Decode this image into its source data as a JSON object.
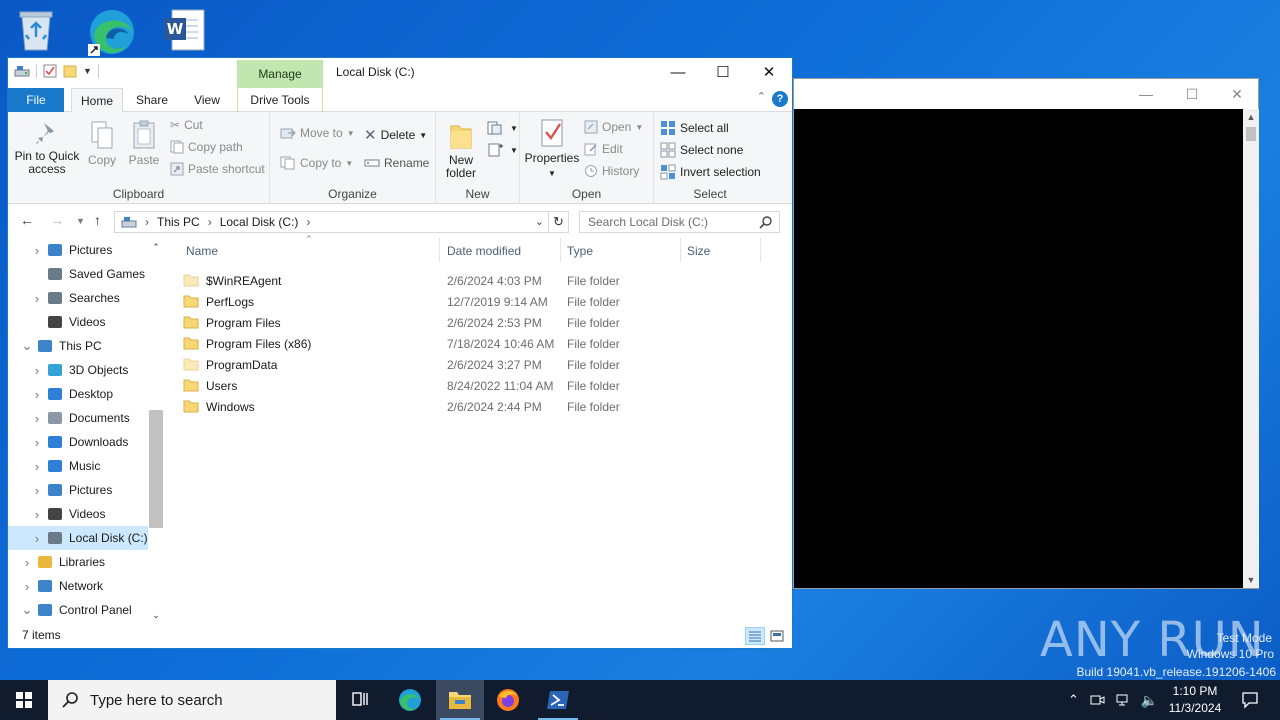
{
  "desktop": {
    "icons": [
      "recycle-bin-icon",
      "edge-icon",
      "word-icon"
    ]
  },
  "explorer": {
    "title": "Local Disk (C:)",
    "contextual_tab": "Manage",
    "tabs": {
      "file": "File",
      "home": "Home",
      "share": "Share",
      "view": "View",
      "drive_tools": "Drive Tools"
    },
    "ribbon": {
      "clipboard": {
        "label": "Clipboard",
        "pin": "Pin to Quick access",
        "copy": "Copy",
        "paste": "Paste",
        "cut": "Cut",
        "copy_path": "Copy path",
        "paste_shortcut": "Paste shortcut"
      },
      "organize": {
        "label": "Organize",
        "move_to": "Move to",
        "copy_to": "Copy to",
        "delete": "Delete",
        "rename": "Rename"
      },
      "new": {
        "label": "New",
        "new_folder": "New folder"
      },
      "open": {
        "label": "Open",
        "properties": "Properties",
        "open": "Open",
        "edit": "Edit",
        "history": "History"
      },
      "select": {
        "label": "Select",
        "select_all": "Select all",
        "select_none": "Select none",
        "invert": "Invert selection"
      }
    },
    "address": {
      "crumbs": [
        "This PC",
        "Local Disk (C:)"
      ],
      "search_placeholder": "Search Local Disk (C:)"
    },
    "nav": [
      {
        "label": "Pictures",
        "icon": "pictures-icon",
        "expandable": true
      },
      {
        "label": "Saved Games",
        "icon": "saved-games-icon",
        "expandable": false
      },
      {
        "label": "Searches",
        "icon": "searches-icon",
        "expandable": true
      },
      {
        "label": "Videos",
        "icon": "videos-icon",
        "expandable": false
      },
      {
        "label": "This PC",
        "icon": "this-pc-icon",
        "expandable": true
      },
      {
        "label": "3D Objects",
        "icon": "3d-objects-icon",
        "expandable": true
      },
      {
        "label": "Desktop",
        "icon": "desktop-icon",
        "expandable": true
      },
      {
        "label": "Documents",
        "icon": "documents-icon",
        "expandable": true
      },
      {
        "label": "Downloads",
        "icon": "downloads-icon",
        "expandable": true
      },
      {
        "label": "Music",
        "icon": "music-icon",
        "expandable": true
      },
      {
        "label": "Pictures",
        "icon": "pictures-icon",
        "expandable": true
      },
      {
        "label": "Videos",
        "icon": "videos-icon",
        "expandable": true
      },
      {
        "label": "Local Disk (C:)",
        "icon": "local-disk-icon",
        "expandable": true
      },
      {
        "label": "Libraries",
        "icon": "libraries-icon",
        "expandable": true
      },
      {
        "label": "Network",
        "icon": "network-icon",
        "expandable": true
      },
      {
        "label": "Control Panel",
        "icon": "control-panel-icon",
        "expandable": true
      }
    ],
    "columns": {
      "name": "Name",
      "date": "Date modified",
      "type": "Type",
      "size": "Size"
    },
    "files": [
      {
        "name": "$WinREAgent",
        "date": "2/6/2024 4:03 PM",
        "type": "File folder"
      },
      {
        "name": "PerfLogs",
        "date": "12/7/2019 9:14 AM",
        "type": "File folder"
      },
      {
        "name": "Program Files",
        "date": "2/6/2024 2:53 PM",
        "type": "File folder"
      },
      {
        "name": "Program Files (x86)",
        "date": "7/18/2024 10:46 AM",
        "type": "File folder"
      },
      {
        "name": "ProgramData",
        "date": "2/6/2024 3:27 PM",
        "type": "File folder"
      },
      {
        "name": "Users",
        "date": "8/24/2022 11:04 AM",
        "type": "File folder"
      },
      {
        "name": "Windows",
        "date": "2/6/2024 2:44 PM",
        "type": "File folder"
      }
    ],
    "status": "7 items"
  },
  "watermark": {
    "brand": "ANY RUN",
    "line1": "Test Mode",
    "line2": "Windows 10 Pro",
    "line3": "Build 19041.vb_release.191206-1406"
  },
  "taskbar": {
    "search_placeholder": "Type here to search",
    "time": "1:10 PM",
    "date": "11/3/2024"
  },
  "colors": {
    "accent": "#1979ca",
    "manage_tab": "#c3e5b0",
    "selection": "#cce8ff",
    "folder": "#f8d775",
    "taskbar": "#101b2d"
  }
}
